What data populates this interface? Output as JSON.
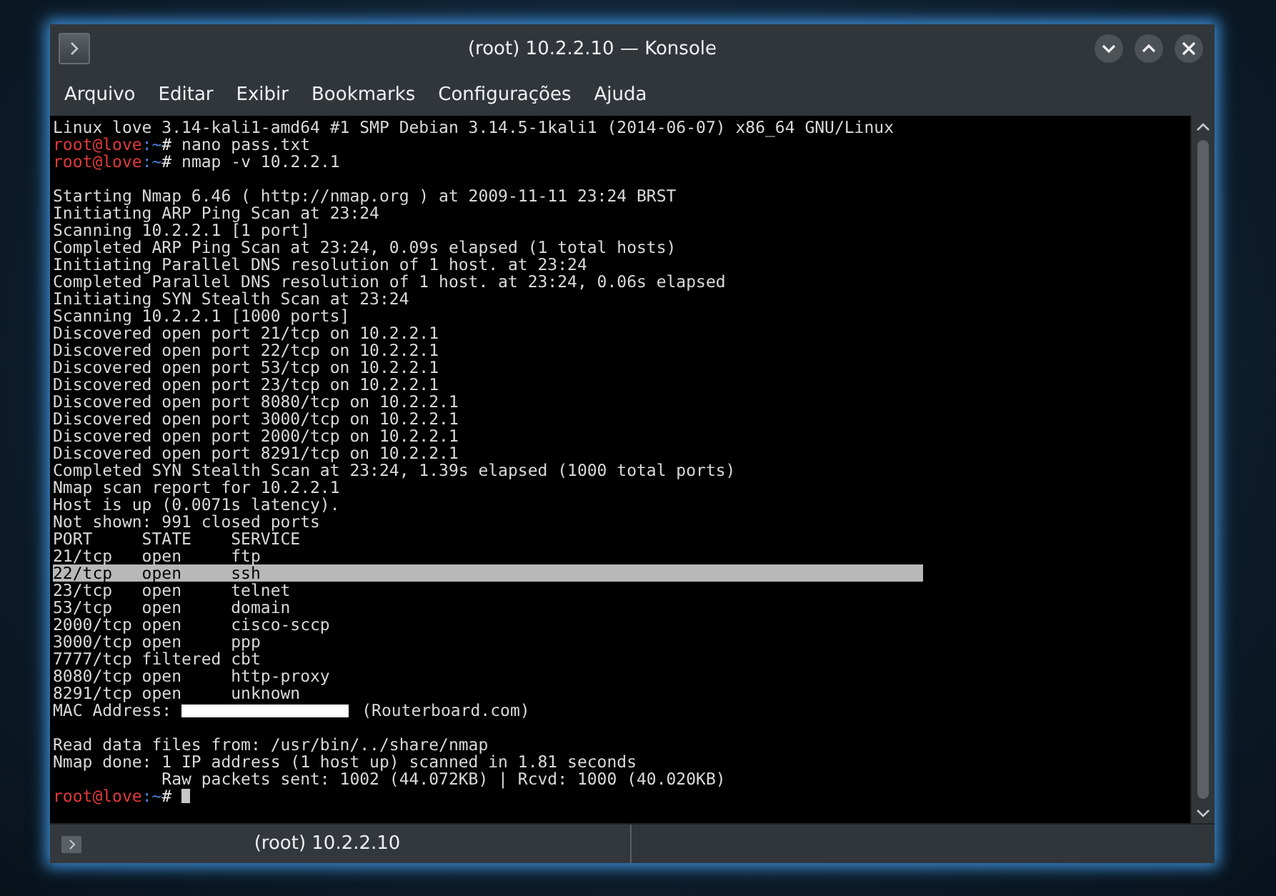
{
  "window": {
    "title": "(root) 10.2.2.10 — Konsole"
  },
  "menu": [
    "Arquivo",
    "Editar",
    "Exibir",
    "Bookmarks",
    "Configurações",
    "Ajuda"
  ],
  "terminal": {
    "lines": [
      {
        "kind": "output",
        "text": "Linux love 3.14-kali1-amd64 #1 SMP Debian 3.14.5-1kali1 (2014-06-07) x86_64 GNU/Linux",
        "highlighted": false
      },
      {
        "kind": "prompt",
        "user": "root@love",
        "path": ":~",
        "symbol": "#",
        "command": "nano pass.txt",
        "cursor": false,
        "highlighted": false
      },
      {
        "kind": "prompt",
        "user": "root@love",
        "path": ":~",
        "symbol": "#",
        "command": "nmap -v 10.2.2.1",
        "cursor": false,
        "highlighted": false
      },
      {
        "kind": "blank",
        "highlighted": false
      },
      {
        "kind": "output",
        "text": "Starting Nmap 6.46 ( http://nmap.org ) at 2009-11-11 23:24 BRST",
        "highlighted": false
      },
      {
        "kind": "output",
        "text": "Initiating ARP Ping Scan at 23:24",
        "highlighted": false
      },
      {
        "kind": "output",
        "text": "Scanning 10.2.2.1 [1 port]",
        "highlighted": false
      },
      {
        "kind": "output",
        "text": "Completed ARP Ping Scan at 23:24, 0.09s elapsed (1 total hosts)",
        "highlighted": false
      },
      {
        "kind": "output",
        "text": "Initiating Parallel DNS resolution of 1 host. at 23:24",
        "highlighted": false
      },
      {
        "kind": "output",
        "text": "Completed Parallel DNS resolution of 1 host. at 23:24, 0.06s elapsed",
        "highlighted": false
      },
      {
        "kind": "output",
        "text": "Initiating SYN Stealth Scan at 23:24",
        "highlighted": false
      },
      {
        "kind": "output",
        "text": "Scanning 10.2.2.1 [1000 ports]",
        "highlighted": false
      },
      {
        "kind": "output",
        "text": "Discovered open port 21/tcp on 10.2.2.1",
        "highlighted": false
      },
      {
        "kind": "output",
        "text": "Discovered open port 22/tcp on 10.2.2.1",
        "highlighted": false
      },
      {
        "kind": "output",
        "text": "Discovered open port 53/tcp on 10.2.2.1",
        "highlighted": false
      },
      {
        "kind": "output",
        "text": "Discovered open port 23/tcp on 10.2.2.1",
        "highlighted": false
      },
      {
        "kind": "output",
        "text": "Discovered open port 8080/tcp on 10.2.2.1",
        "highlighted": false
      },
      {
        "kind": "output",
        "text": "Discovered open port 3000/tcp on 10.2.2.1",
        "highlighted": false
      },
      {
        "kind": "output",
        "text": "Discovered open port 2000/tcp on 10.2.2.1",
        "highlighted": false
      },
      {
        "kind": "output",
        "text": "Discovered open port 8291/tcp on 10.2.2.1",
        "highlighted": false
      },
      {
        "kind": "output",
        "text": "Completed SYN Stealth Scan at 23:24, 1.39s elapsed (1000 total ports)",
        "highlighted": false
      },
      {
        "kind": "output",
        "text": "Nmap scan report for 10.2.2.1",
        "highlighted": false
      },
      {
        "kind": "output",
        "text": "Host is up (0.0071s latency).",
        "highlighted": false
      },
      {
        "kind": "output",
        "text": "Not shown: 991 closed ports",
        "highlighted": false
      },
      {
        "kind": "output",
        "text": "PORT     STATE    SERVICE",
        "highlighted": false
      },
      {
        "kind": "output",
        "text": "21/tcp   open     ftp",
        "highlighted": false
      },
      {
        "kind": "output",
        "text": "22/tcp   open     ssh",
        "highlighted": true
      },
      {
        "kind": "output",
        "text": "23/tcp   open     telnet",
        "highlighted": false
      },
      {
        "kind": "output",
        "text": "53/tcp   open     domain",
        "highlighted": false
      },
      {
        "kind": "output",
        "text": "2000/tcp open     cisco-sccp",
        "highlighted": false
      },
      {
        "kind": "output",
        "text": "3000/tcp open     ppp",
        "highlighted": false
      },
      {
        "kind": "output",
        "text": "7777/tcp filtered cbt",
        "highlighted": false
      },
      {
        "kind": "output",
        "text": "8080/tcp open     http-proxy",
        "highlighted": false
      },
      {
        "kind": "output",
        "text": "8291/tcp open     unknown",
        "highlighted": false
      },
      {
        "kind": "redacted",
        "before": "MAC Address:",
        "after": "(Routerboard.com)",
        "highlighted": false
      },
      {
        "kind": "blank",
        "highlighted": false
      },
      {
        "kind": "output",
        "text": "Read data files from: /usr/bin/../share/nmap",
        "highlighted": false
      },
      {
        "kind": "output",
        "text": "Nmap done: 1 IP address (1 host up) scanned in 1.81 seconds",
        "highlighted": false
      },
      {
        "kind": "output",
        "text": "           Raw packets sent: 1002 (44.072KB) | Rcvd: 1000 (40.020KB)",
        "highlighted": false
      },
      {
        "kind": "prompt",
        "user": "root@love",
        "path": ":~",
        "symbol": "#",
        "cursor": true,
        "highlighted": false
      }
    ]
  },
  "tabs": [
    {
      "label": "(root) 10.2.2.10",
      "selected": true
    }
  ]
}
